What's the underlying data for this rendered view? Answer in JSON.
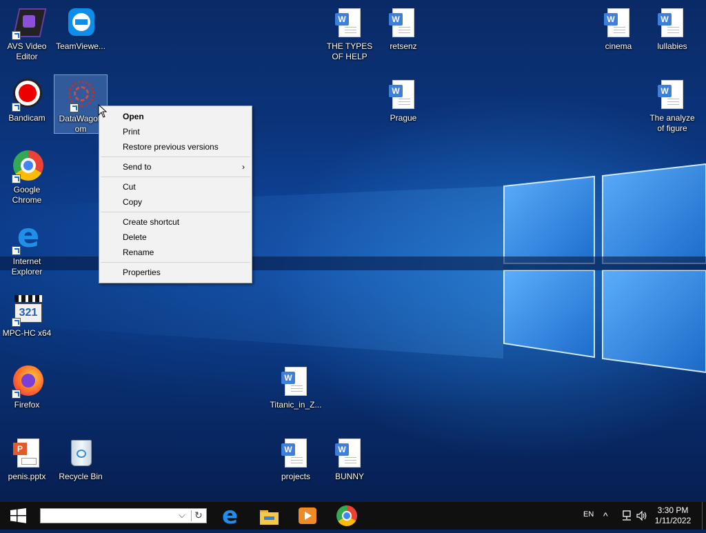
{
  "desktop_icons": [
    {
      "label": "AVS Video Editor"
    },
    {
      "label": "TeamViewe..."
    },
    {
      "label": "Bandicam"
    },
    {
      "label": "DataWagon om"
    },
    {
      "label": "Google Chrome"
    },
    {
      "label": "Internet Explorer"
    },
    {
      "label": "MPC-HC x64"
    },
    {
      "label": "Firefox"
    },
    {
      "label": "penis.pptx"
    },
    {
      "label": "Recycle Bin"
    },
    {
      "label": "THE TYPES OF HELP"
    },
    {
      "label": "retsenz"
    },
    {
      "label": "Prague"
    },
    {
      "label": "cinema"
    },
    {
      "label": "lullabies"
    },
    {
      "label": "The analyze of figure"
    },
    {
      "label": "Titanic_in_Z..."
    },
    {
      "label": "projects"
    },
    {
      "label": "BUNNY"
    }
  ],
  "context_menu": {
    "open": "Open",
    "print": "Print",
    "restore": "Restore previous versions",
    "send_to": "Send to",
    "submenu_arrow": "›",
    "cut": "Cut",
    "copy": "Copy",
    "create_shortcut": "Create shortcut",
    "delete": "Delete",
    "rename": "Rename",
    "properties": "Properties"
  },
  "taskbar": {
    "search_dropdown_glyph": "⌵",
    "search_refresh_glyph": "↻",
    "pinned": [
      "edge-icon",
      "file-explorer-icon",
      "media-player-icon",
      "chrome-icon"
    ],
    "language": "EN",
    "tray_up": "^",
    "time": "3:30 PM",
    "date": "1/11/2022"
  },
  "colors": {
    "accent": "#3f7fd9",
    "taskbar": "#101010",
    "menu_bg": "#f2f2f2"
  }
}
